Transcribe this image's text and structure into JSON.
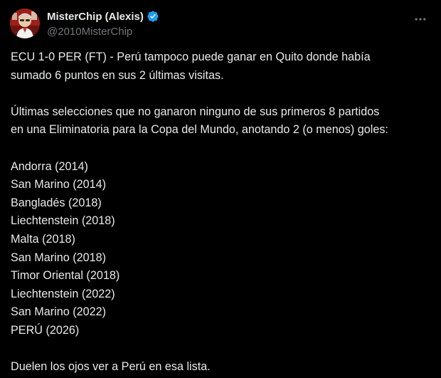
{
  "author": {
    "display_name": "MisterChip (Alexis)",
    "handle": "@2010MisterChip",
    "avatar_icon": "avatar-image",
    "verified_icon": "verified-badge-icon",
    "verified_color": "#1d9bf0"
  },
  "menu_icon": "more-options-icon",
  "tweet": {
    "line1": "ECU 1-0 PER (FT) - Perú tampoco puede ganar en Quito donde había",
    "line2": "sumado 6 puntos en sus 2 últimas visitas.",
    "line3": "Últimas selecciones que no ganaron ninguno de sus primeros 8 partidos",
    "line4": "en una Eliminatoria para la Copa del Mundo, anotando 2 (o menos) goles:",
    "list": [
      "Andorra (2014)",
      "San Marino (2014)",
      "Bangladés (2018)",
      "Liechtenstein (2018)",
      "Malta (2018)",
      "San Marino (2018)",
      "Timor Oriental (2018)",
      "Liechtenstein (2022)",
      "San Marino (2022)",
      "PERÚ (2026)"
    ],
    "closing": "Duelen los ojos ver a Perú en esa lista."
  },
  "colors": {
    "background": "#000000",
    "text": "#e7e9ea",
    "secondary_text": "#71767b",
    "accent": "#1d9bf0"
  }
}
